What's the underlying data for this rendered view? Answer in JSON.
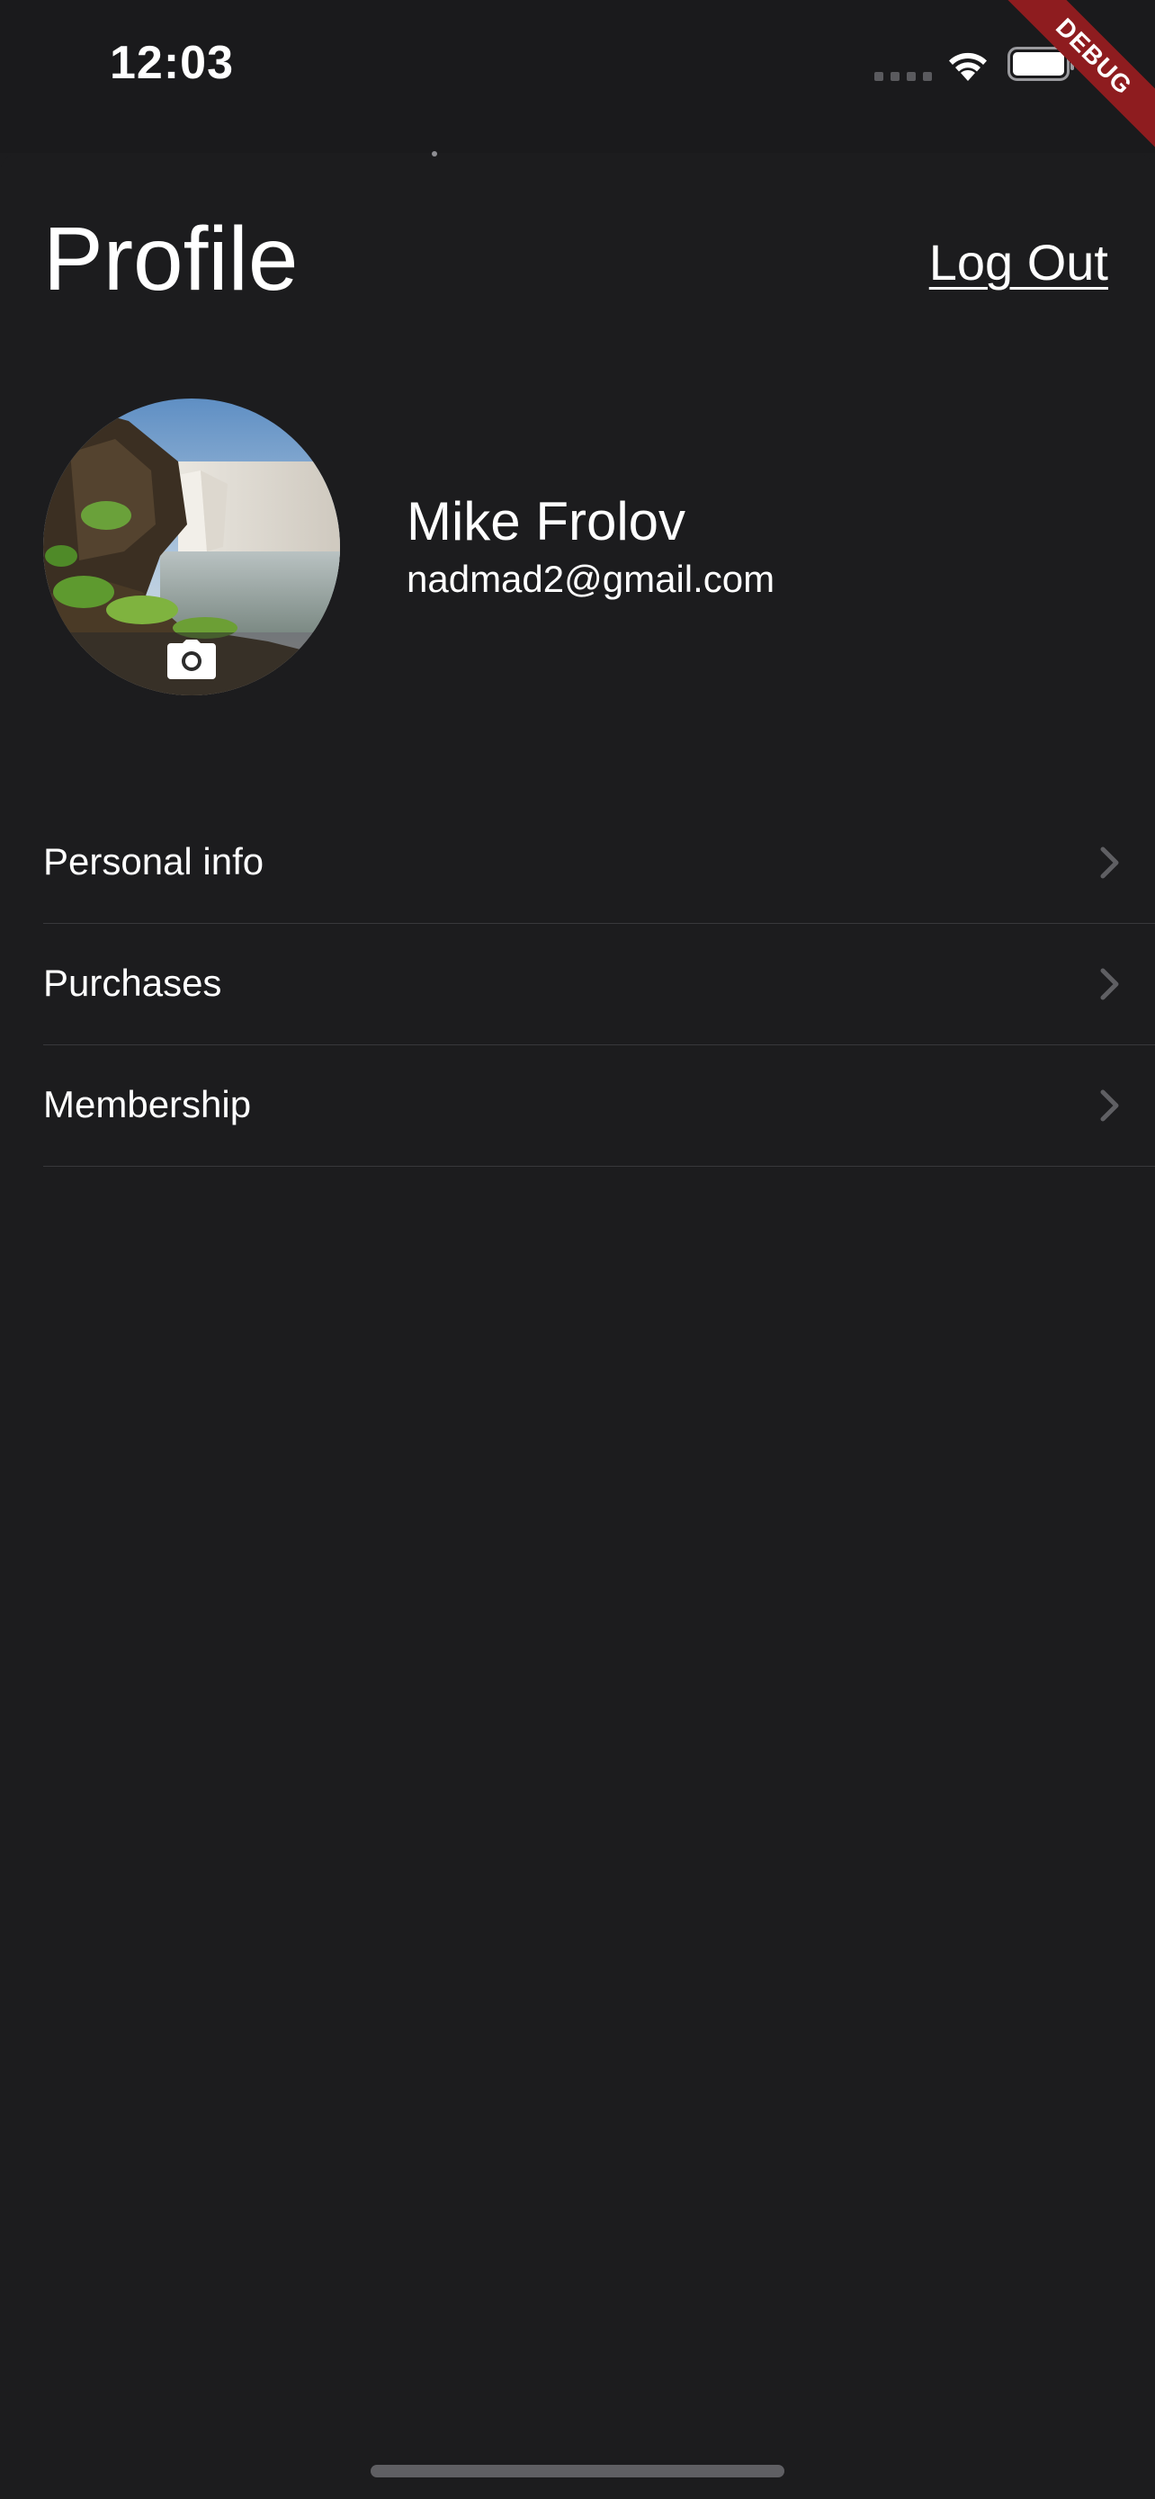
{
  "status_bar": {
    "time": "12:03",
    "debug_label": "DEBUG"
  },
  "header": {
    "title": "Profile",
    "logout_label": "Log Out"
  },
  "profile": {
    "name": "Mike Frolov",
    "email": "nadmad2@gmail.com"
  },
  "menu": {
    "items": [
      {
        "label": "Personal info"
      },
      {
        "label": "Purchases"
      },
      {
        "label": "Membership"
      }
    ]
  },
  "colors": {
    "background": "#1c1c1e",
    "text": "#ffffff",
    "divider": "#38383b",
    "chevron": "#5f5f63",
    "debug_ribbon": "#8e1c1f"
  },
  "icons": [
    "wifi-icon",
    "battery-icon",
    "camera-icon",
    "chevron-right-icon"
  ]
}
